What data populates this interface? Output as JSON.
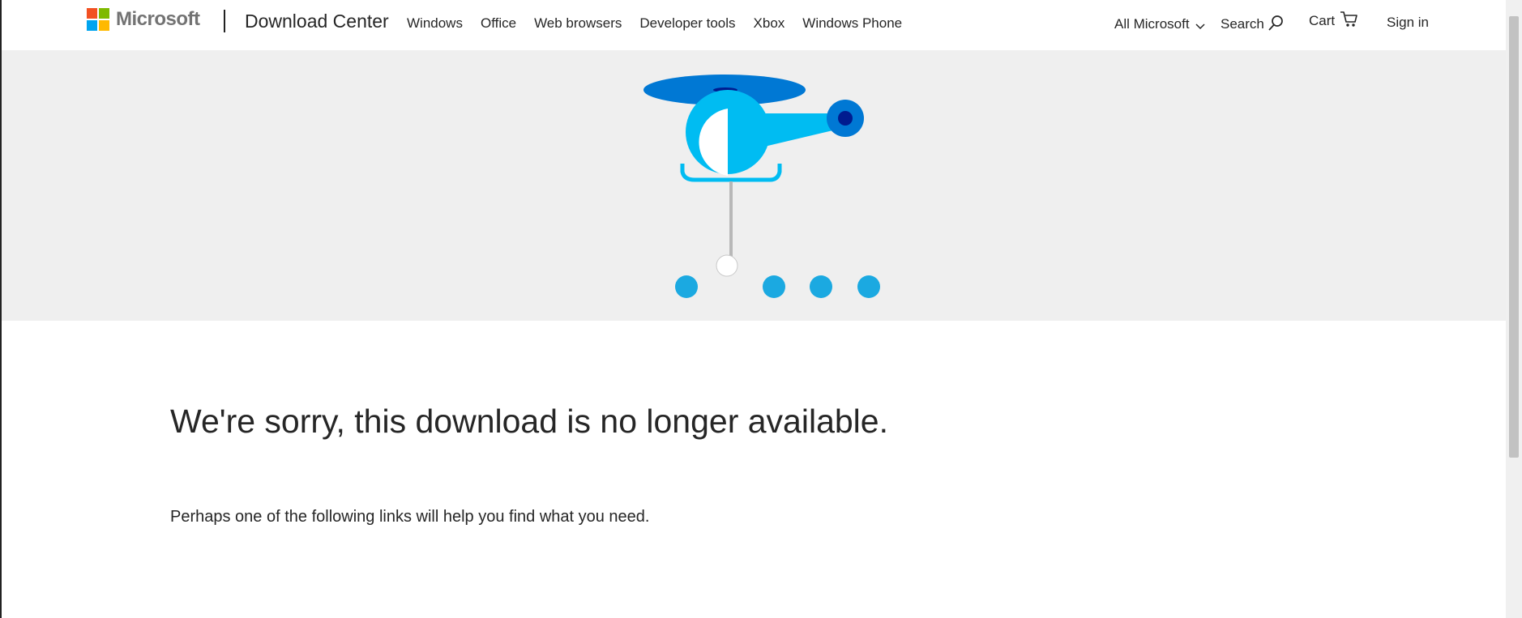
{
  "brand": {
    "name": "Microsoft",
    "logo_colors": [
      "#f25022",
      "#7fba00",
      "#00a4ef",
      "#ffb900"
    ]
  },
  "header": {
    "site_title": "Download Center",
    "nav_items": [
      "Windows",
      "Office",
      "Web browsers",
      "Developer tools",
      "Xbox",
      "Windows Phone"
    ],
    "all_microsoft": "All Microsoft",
    "search": "Search",
    "cart": "Cart",
    "sign_in": "Sign in"
  },
  "main": {
    "heading": "We're sorry, this download is no longer available.",
    "subtext": "Perhaps one of the following links will help you find what you need."
  },
  "colors": {
    "hero_bg": "#efefef",
    "rotor": "#0078d4",
    "body_light": "#00bcf2",
    "dots": "#1ba9e1",
    "dark_accent": "#001b8f"
  },
  "icons": {
    "search": "search-icon",
    "cart": "cart-icon",
    "chevron": "chevron-down-icon"
  }
}
